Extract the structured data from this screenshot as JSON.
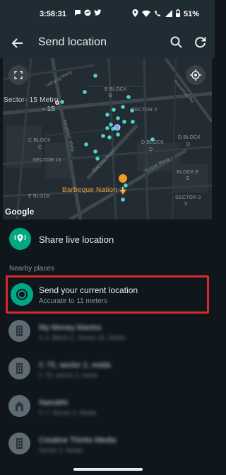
{
  "status_bar": {
    "time": "3:58:31",
    "battery": "51%",
    "icons": [
      "chat-bubble-icon",
      "messenger-icon",
      "twitter-icon",
      "location-icon",
      "wifi-icon",
      "call-icon",
      "signal-icon",
      "battery-icon"
    ]
  },
  "app_bar": {
    "title": "Send location",
    "icons": [
      "back-arrow-icon",
      "search-icon",
      "refresh-icon"
    ]
  },
  "map": {
    "labels": {
      "udhyog": "Udhyog Marg",
      "b_block": "B BLOCK",
      "b": "B",
      "sector2": "SECTOR 2",
      "sector15metro": "Sector- 15 Metro",
      "minus15": "- 15",
      "c_block": "C BLOCK",
      "c": "C",
      "sector15": "SECTOR 15",
      "d_block": "D BLOCK",
      "d": "D",
      "d_block2": "D BLOCK",
      "d2": "D",
      "hanuman": "Hanuman Rd",
      "bhim": "Amaltash Marg",
      "redfm": "Red FM Road",
      "vyapar": "Vyapar Marg",
      "block_e": "BLOCK E",
      "e": "E",
      "e_block": "E BLOCK",
      "sector3": "SECTOR 3",
      "three": "3",
      "barbeque": "Barbeque Nation",
      "google": "Google"
    }
  },
  "share_live": {
    "label": "Share live location"
  },
  "nearby": {
    "section_label": "Nearby places"
  },
  "current": {
    "title": "Send your current location",
    "subtitle": "Accurate to 11 meters"
  },
  "places": [
    {
      "name": "My Money Mantra",
      "address": "C 4, Block C, Sector 15, Noida"
    },
    {
      "name": "C 75, sector 2, noida",
      "address": "C 75, sector 2, noida"
    },
    {
      "name": "Nanubhi",
      "address": "C 7, Sector 2, Noida"
    },
    {
      "name": "Creative Thinks Media",
      "address": "Sector 2, Noida"
    }
  ],
  "colors": {
    "accent": "#00a884",
    "highlight_border": "#d9292a",
    "app_bar": "#1f2c33",
    "background": "#0f171c"
  }
}
